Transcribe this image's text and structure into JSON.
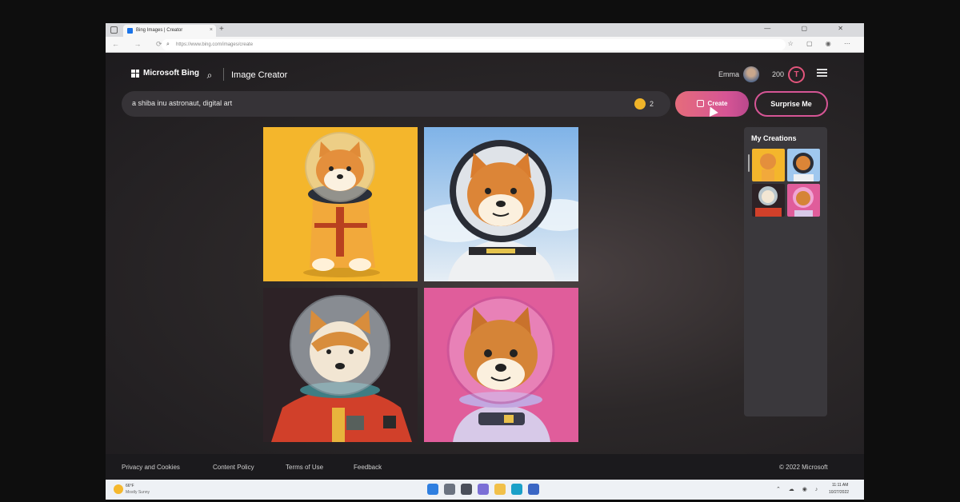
{
  "browser": {
    "tab_title": "Bing Images | Creator",
    "tab_close": "×",
    "new_tab": "+",
    "url": "https://www.bing.com/images/create",
    "window_buttons": "— ▢ ✕"
  },
  "header": {
    "brand": "Microsoft Bing",
    "product": "Image Creator",
    "user_name": "Emma",
    "reward_points": "200"
  },
  "prompt": {
    "text": "a shiba inu astronaut, digital art",
    "boosts": "2"
  },
  "actions": {
    "create_label": "Create",
    "surprise_label": "Surprise Me"
  },
  "results": {
    "images": [
      "shiba-astronaut-yellow",
      "shiba-astronaut-blue",
      "shiba-astronaut-red",
      "shiba-astronaut-pink"
    ]
  },
  "creations": {
    "title": "My Creations"
  },
  "footer": {
    "links": [
      "Privacy and Cookies",
      "Content Policy",
      "Terms of Use",
      "Feedback"
    ],
    "copyright": "© 2022 Microsoft"
  },
  "taskbar": {
    "weather_temp": "66°F",
    "weather_desc": "Mostly Sunny",
    "time": "11:11 AM",
    "date": "10/27/2022"
  },
  "colors": {
    "accent": "#d65595",
    "boost": "#f0b429"
  }
}
